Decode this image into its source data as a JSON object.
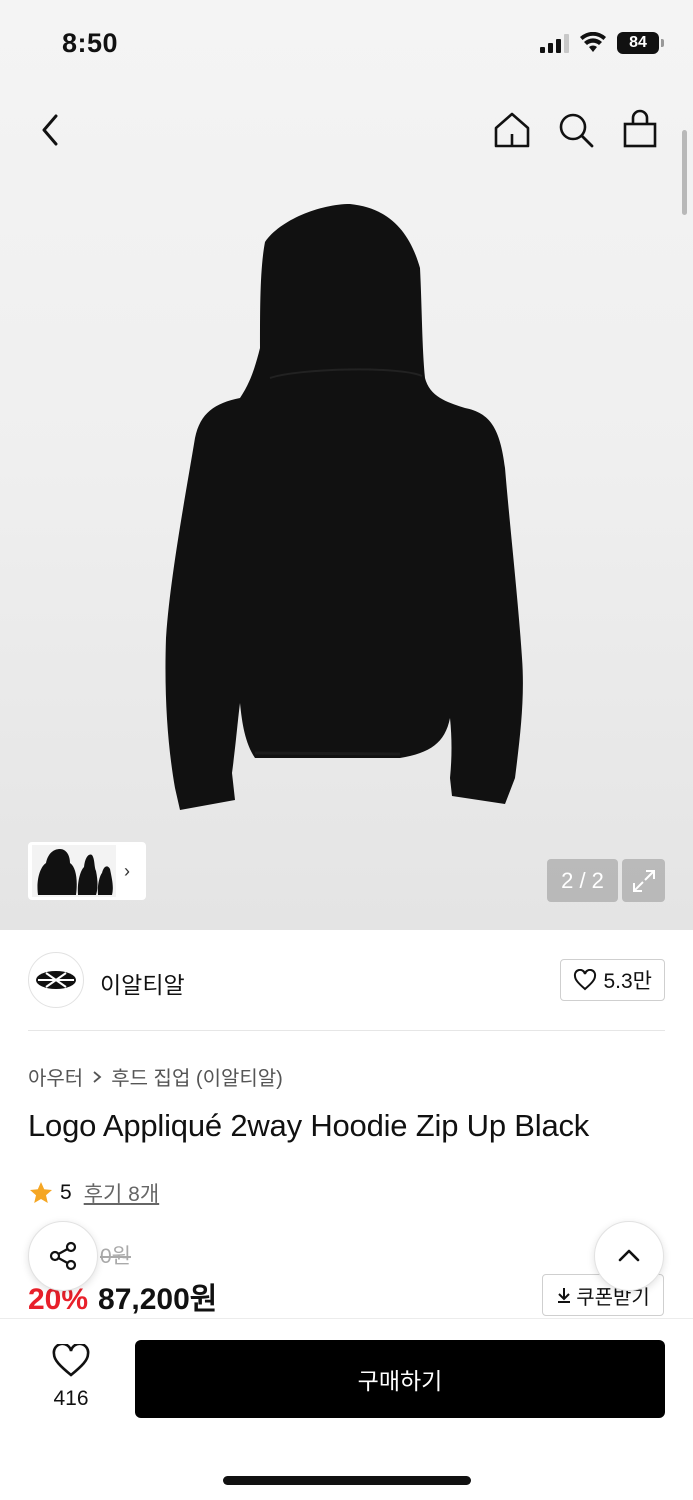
{
  "status": {
    "time": "8:50",
    "battery": "84"
  },
  "gallery": {
    "counter": "2 / 2"
  },
  "brand": {
    "name": "이알티알",
    "likes": "5.3만"
  },
  "breadcrumb": {
    "category": "아우터",
    "subcategory": "후드 집업 (이알티알)"
  },
  "product": {
    "title": "Logo Appliqué 2way Hoodie Zip Up Black",
    "rating": "5",
    "reviews": "후기 8개",
    "original_price": "0원",
    "discount": "20%",
    "price": "87,200원",
    "coupon_label": "쿠폰받기"
  },
  "bottom": {
    "wish_count": "416",
    "buy_label": "구매하기"
  },
  "icons": [
    "chevron-left-icon",
    "home-icon",
    "search-icon",
    "bag-icon",
    "expand-icon",
    "heart-icon",
    "star-icon",
    "share-icon",
    "chevron-up-icon",
    "download-icon"
  ],
  "colors": {
    "accent_red": "#e8202a",
    "star": "#f5a623",
    "buy_button": "#000000"
  }
}
